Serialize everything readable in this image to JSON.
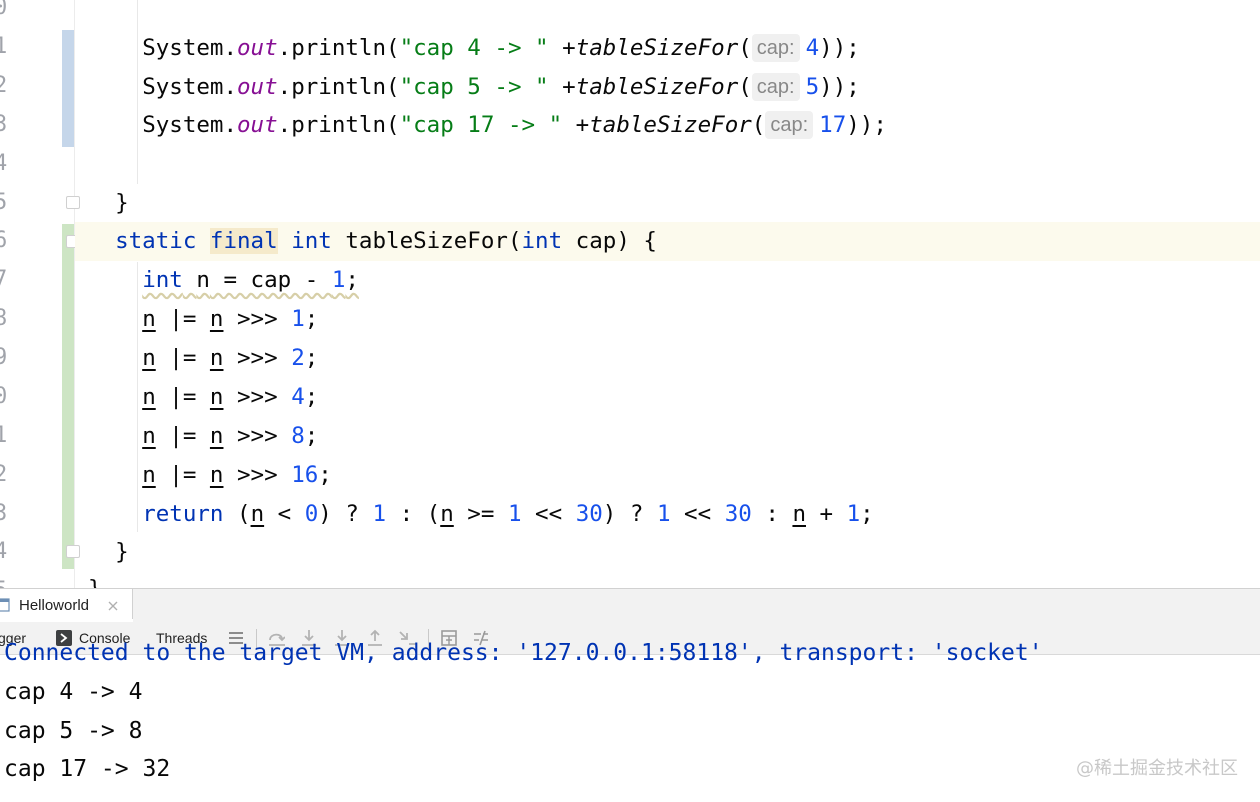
{
  "editor": {
    "line_numbers": [
      "0",
      "1",
      "2",
      "3",
      "4",
      "5",
      "6",
      "7",
      "8",
      "9",
      "0",
      "1",
      "2",
      "3",
      "4",
      "5"
    ],
    "tokens": {
      "system": "System",
      "dot": ".",
      "out": "out",
      "println": "println",
      "open_paren": "(",
      "plus": " +",
      "call_name": "tableSizeFor",
      "hint_label": "cap:",
      "close_semi": "));",
      "str_cap4": "\"cap 4 -> \"",
      "str_cap5": "\"cap 5 -> \"",
      "str_cap17": "\"cap 17 -> \"",
      "arg4": "4",
      "arg5": "5",
      "arg17": "17",
      "brace_close": "}",
      "static": "static",
      "final": "final",
      "int": "int",
      "method_name": "tableSizeFor",
      "param_open": "(",
      "param_rest": " cap) {",
      "n": "n",
      "assign_mid": " = cap - ",
      "one": "1",
      "semi": ";",
      "or_assign": " |= ",
      "shift": " >>> ",
      "s1": "1",
      "s2": "2",
      "s4": "4",
      "s8": "8",
      "s16": "16",
      "return": "return",
      "r_open": " (",
      "r_lt": " < ",
      "r_zero": "0",
      "r_q1": ") ? ",
      "r_one": "1",
      "r_colon_open": " : (",
      "r_ge": " >= ",
      "r_shl": " << ",
      "r_thirty": "30",
      "r_q2": ") ? ",
      "r_colon": " : ",
      "r_plus": " + ",
      "r_end": ";"
    }
  },
  "debug": {
    "session_tab": "Helloworld",
    "toolbar": {
      "debugger_label": "gger",
      "console_label": "Console",
      "threads_label": "Threads"
    },
    "icons": [
      "menu-icon",
      "step-over-icon",
      "step-into-icon",
      "force-step-into-icon",
      "step-out-icon",
      "run-to-cursor-icon",
      "evaluate-icon",
      "trace-icon"
    ],
    "console_lines": [
      "Connected to the target VM, address: '127.0.0.1:58118', transport: 'socket'",
      "cap 4 -> 4",
      "cap 5 -> 8",
      "cap 17 -> 32"
    ]
  },
  "watermark": "@稀土掘金技术社区",
  "colors": {
    "keyword": "#0033b3",
    "number": "#1750eb",
    "string": "#067d17",
    "field": "#871094",
    "changed_bar": "#c5d6ea",
    "added_bar": "#cde5c4"
  }
}
